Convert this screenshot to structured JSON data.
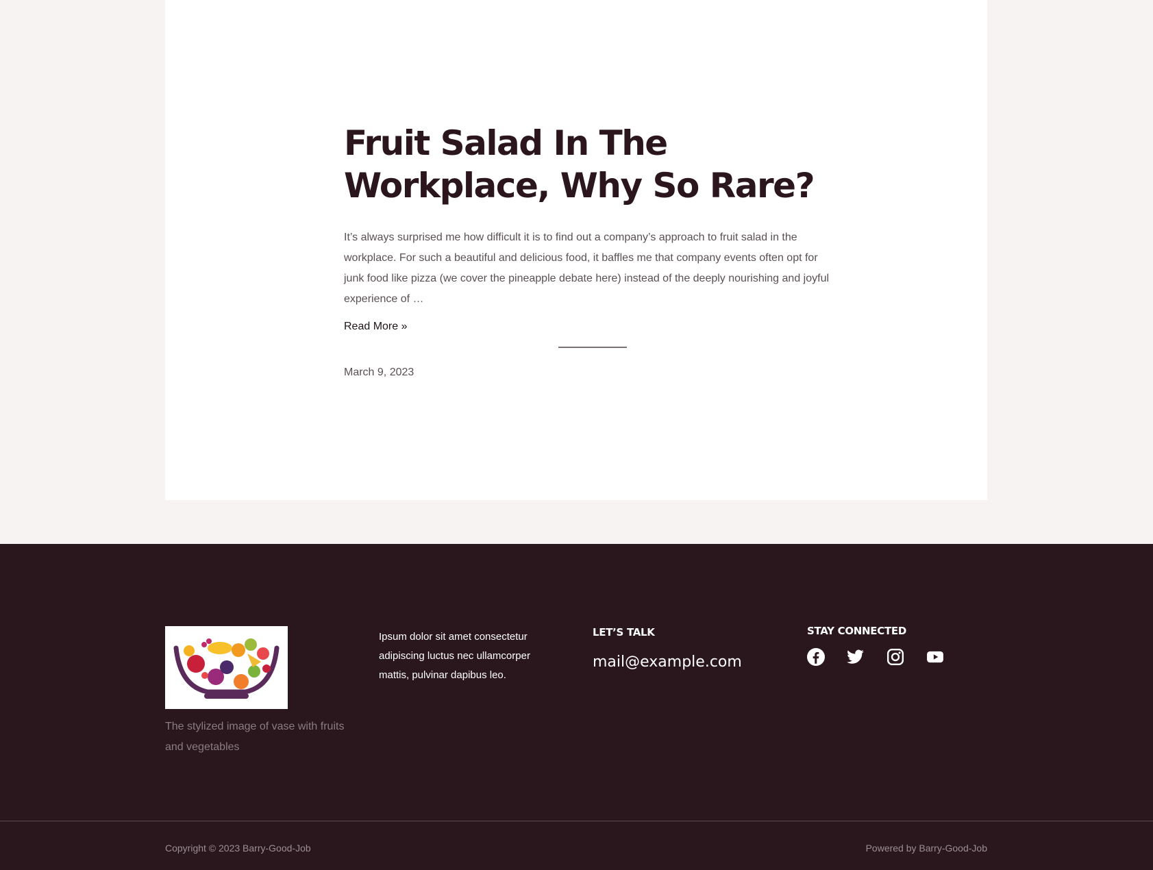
{
  "post": {
    "title": "Fruit Salad In The Workplace, Why So Rare?",
    "excerpt": "It’s always surprised me how difficult it is to find out a company’s approach to fruit salad in the workplace. For such a beautiful and delicious food, it baffles me that company events often opt for junk food like pizza (we cover the pineapple debate here) instead of the deeply nourishing and joyful experience of …",
    "read_more": "Read More »",
    "date": "March 9, 2023"
  },
  "footer": {
    "logo_caption": "The stylized image of vase with fruits and vegetables",
    "about_text": "Ipsum dolor sit amet consectetur adipiscing luctus nec ullamcorper mattis, pulvinar dapibus leo.",
    "talk_heading": "LET’S TALK",
    "email": "mail@example.com",
    "connect_heading": "STAY CONNECTED",
    "socials": [
      "facebook-icon",
      "twitter-icon",
      "instagram-icon",
      "youtube-icon"
    ],
    "copyright": "Copyright © 2023 Barry-Good-Job",
    "powered_by": "Powered by Barry-Good-Job"
  },
  "colors": {
    "page_background": "#f7f3f3",
    "card_background": "#ffffff",
    "footer_background": "#2a171d",
    "title_color": "#2a161c"
  }
}
